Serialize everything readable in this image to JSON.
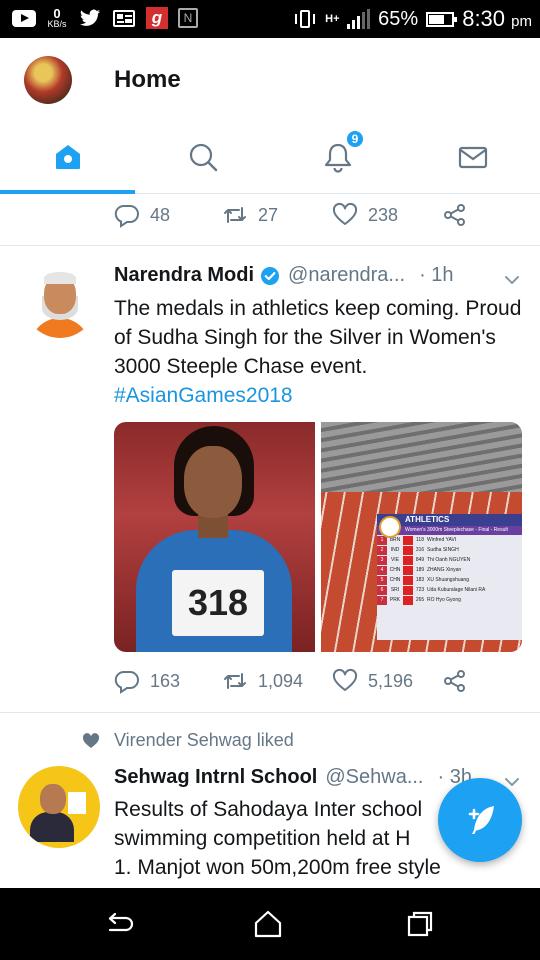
{
  "status_bar": {
    "net_speed_value": "0",
    "net_speed_unit": "KB/s",
    "network_type": "H+",
    "battery_percent": "65%",
    "time": "8:30",
    "ampm": "pm",
    "notification_g_label": "g",
    "notification_n_label": "N"
  },
  "header": {
    "title": "Home"
  },
  "tabs": {
    "items": [
      {
        "name": "home",
        "icon": "home-icon",
        "active": true
      },
      {
        "name": "search",
        "icon": "search-icon",
        "active": false
      },
      {
        "name": "notifications",
        "icon": "bell-icon",
        "active": false,
        "badge": "9"
      },
      {
        "name": "messages",
        "icon": "mail-icon",
        "active": false
      }
    ]
  },
  "prev_tweet": {
    "replies": "48",
    "retweets": "27",
    "likes": "238"
  },
  "tweet1": {
    "name": "Narendra Modi",
    "handle": "@narendra...",
    "time": "· 1h",
    "text": "The medals in athletics keep coming. Proud of Sudha Singh for the Silver in Women's 3000 Steeple Chase event.",
    "hashtag": "#AsianGames2018",
    "replies": "163",
    "retweets": "1,094",
    "likes": "5,196",
    "bib_number": "318",
    "results_graphic": {
      "heading": "ATHLETICS",
      "subheading": "Women's 3000m Steeplechase - Final - Result",
      "rows": [
        {
          "rank": "1",
          "country": "BRN",
          "bib": "118",
          "name": "Winfred YAVI"
        },
        {
          "rank": "2",
          "country": "IND",
          "bib": "316",
          "name": "Sudha SINGH"
        },
        {
          "rank": "3",
          "country": "VIE",
          "bib": "849",
          "name": "Thi Oanh NGUYEN"
        },
        {
          "rank": "4",
          "country": "CHN",
          "bib": "189",
          "name": "ZHANG Xinyan"
        },
        {
          "rank": "5",
          "country": "CHN",
          "bib": "183",
          "name": "XU Shuangshuang"
        },
        {
          "rank": "6",
          "country": "SRI",
          "bib": "723",
          "name": "Uda Kuburalage Nilani RA"
        },
        {
          "rank": "7",
          "country": "PRK",
          "bib": "265",
          "name": "RO Hyo Gyong"
        }
      ]
    }
  },
  "liked_context": {
    "text": "Virender Sehwag liked"
  },
  "tweet2": {
    "name": "Sehwag Intrnl School",
    "handle": "@Sehwa...",
    "time": "· 3h",
    "text_line1": "Results of Sahodaya Inter school",
    "text_line2": "swimming competition held at H",
    "text_line3": "1. Manjot won 50m,200m free style"
  },
  "colors": {
    "accent": "#1da1f2",
    "link": "#1b95e0",
    "muted": "#657786",
    "text": "#14171a",
    "divider": "#e1e8ed"
  }
}
